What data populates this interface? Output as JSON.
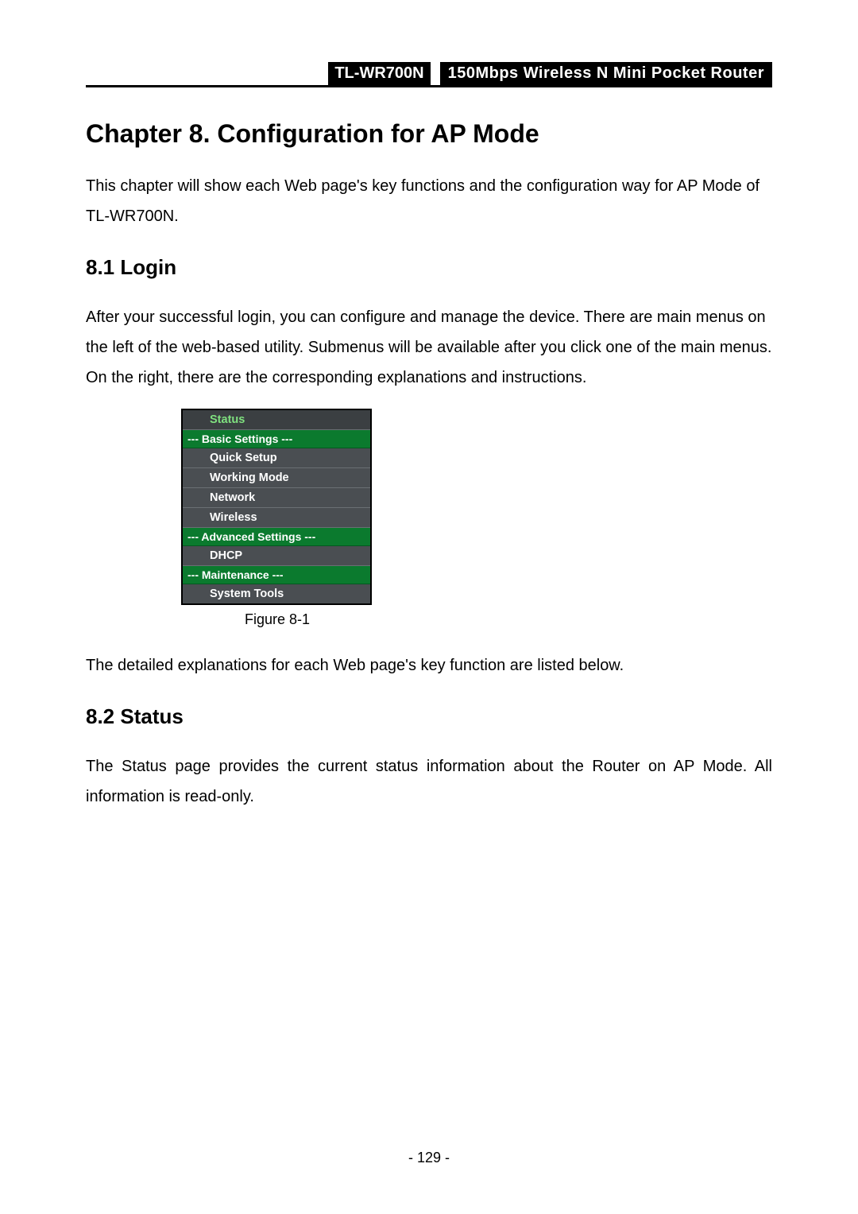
{
  "header": {
    "model": "TL-WR700N",
    "desc": "150Mbps Wireless N Mini Pocket Router"
  },
  "chapter": {
    "title": "Chapter 8.   Configuration for AP Mode",
    "intro": "This chapter will show each Web page's key functions and the configuration way for AP Mode of TL-WR700N."
  },
  "s81": {
    "title": "8.1  Login",
    "body": "After your successful login, you can configure and manage the device. There are main menus on the left of the web-based utility. Submenus will be available after you click one of the main menus. On the right, there are the corresponding explanations and instructions."
  },
  "menu": {
    "status": "Status",
    "g_basic": "--- Basic Settings ---",
    "quick": "Quick Setup",
    "working": "Working Mode",
    "network": "Network",
    "wireless": "Wireless",
    "g_adv": "--- Advanced Settings ---",
    "dhcp": "DHCP",
    "g_maint": "--- Maintenance ---",
    "systools": "System Tools"
  },
  "figure_caption": "Figure 8-1",
  "after_figure": "The detailed explanations for each Web page's key function are listed below.",
  "s82": {
    "title": "8.2  Status",
    "body": "The Status page provides the current status information about the Router on AP Mode. All information is read-only."
  },
  "page_number": "- 129 -"
}
